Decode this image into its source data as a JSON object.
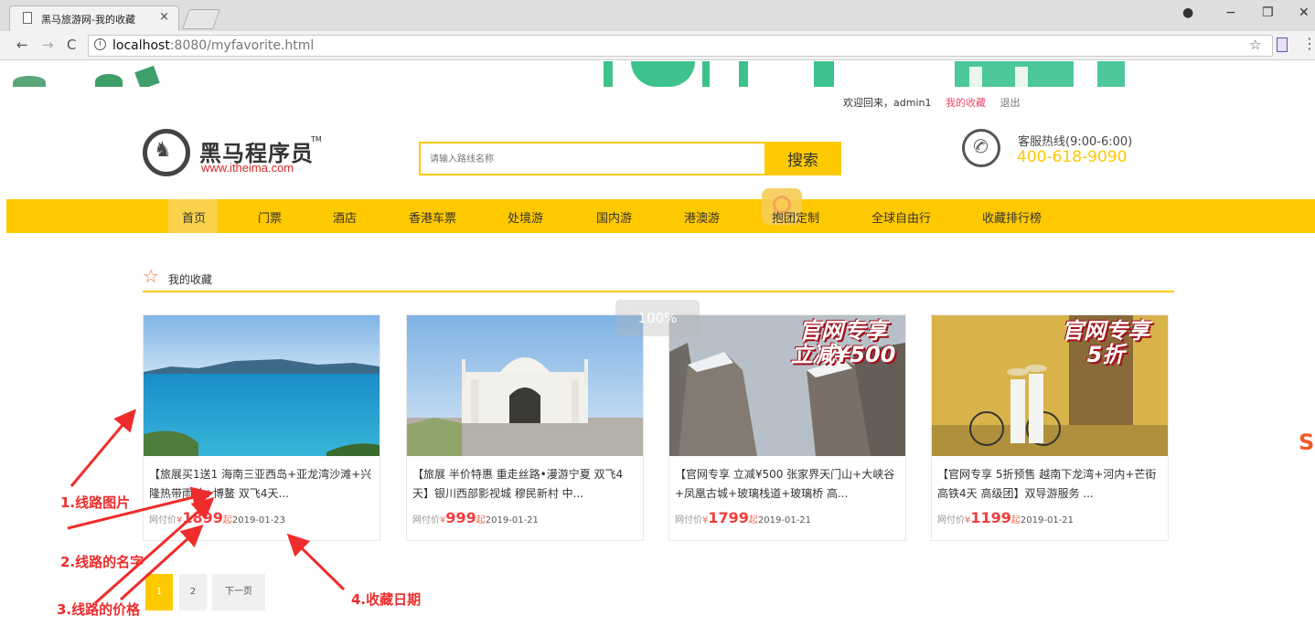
{
  "browser": {
    "tab_title": "黑马旅游网-我的收藏",
    "tab_close": "×",
    "url_host": "localhost",
    "url_rest": ":8080/myfavorite.html",
    "back": "←",
    "forward": "→",
    "reload": "C",
    "star": "☆",
    "menu": "⋮",
    "minimize": "−",
    "maximize": "❐",
    "close": "✕",
    "account": "●"
  },
  "header": {
    "welcome": "欢迎回来，admin1",
    "my_favorites": "我的收藏",
    "logout": "退出",
    "logo_cn": "黑马程序员",
    "logo_tm": "TM",
    "logo_en": "www.itheima.com",
    "search_placeholder": "请输入路线名称",
    "search_button": "搜索",
    "hotline_label": "客服热线(9:00-6:00)",
    "hotline_number": "400-618-9090"
  },
  "nav": {
    "items": [
      "首页",
      "门票",
      "酒店",
      "香港车票",
      "处境游",
      "国内游",
      "港澳游",
      "抱团定制",
      "全球自由行",
      "收藏排行榜"
    ]
  },
  "section": {
    "title": "我的收藏"
  },
  "zoom": "100%",
  "cards": [
    {
      "name": "【旅展买1送1 海南三亚西岛+亚龙湾沙滩+兴隆热带雨林+博鳌 双飞4天...",
      "price_label": "网付价",
      "currency": "¥",
      "price": "1899",
      "suffix": "起",
      "date": "2019-01-23",
      "promo": ""
    },
    {
      "name": "【旅展 半价特惠 重走丝路•漫游宁夏 双飞4天】银川西部影视城 穆民新村 中...",
      "price_label": "网付价",
      "currency": "¥",
      "price": "999",
      "suffix": "起",
      "date": "2019-01-21",
      "promo": ""
    },
    {
      "name": "【官网专享 立减¥500 张家界天门山+大峡谷+凤凰古城+玻璃栈道+玻璃桥 高...",
      "price_label": "网付价",
      "currency": "¥",
      "price": "1799",
      "suffix": "起",
      "date": "2019-01-21",
      "promo": "官网专享\n立减¥500"
    },
    {
      "name": "【官网专享 5折预售 越南下龙湾+河内+芒街 高铁4天 高级团】双导游服务 ...",
      "price_label": "网付价",
      "currency": "¥",
      "price": "1199",
      "suffix": "起",
      "date": "2019-01-21",
      "promo": "官网专享\n5折"
    }
  ],
  "pagination": {
    "pages": [
      "1",
      "2"
    ],
    "next": "下一页",
    "active": "1"
  },
  "annotations": {
    "label1": "1.线路图片",
    "label2": "2.线路的名字",
    "label3": "3.线路的价格",
    "label4": "4.收藏日期",
    "color": "#ef2c2c"
  },
  "colors": {
    "accent_yellow": "#ffc900",
    "price_red": "#f23c3c"
  }
}
